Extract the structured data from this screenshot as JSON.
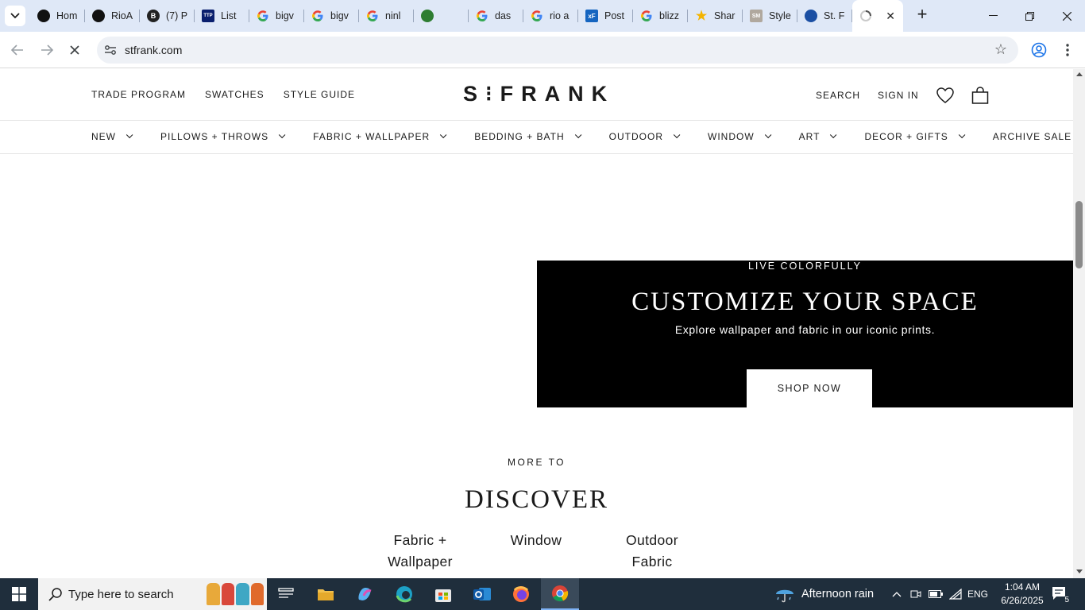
{
  "browser": {
    "tabs": [
      {
        "title": "Hom",
        "icon": "threads-icon",
        "color": "#111111"
      },
      {
        "title": "RioA",
        "icon": "threads-icon",
        "color": "#111111"
      },
      {
        "title": "(7) P",
        "icon": "b-icon",
        "color": "#222222"
      },
      {
        "title": "List",
        "icon": "ttp-icon",
        "color": "#0a1f6e"
      },
      {
        "title": "bigv",
        "icon": "google-icon",
        "color": "#4285f4"
      },
      {
        "title": "bigv",
        "icon": "google-icon",
        "color": "#4285f4"
      },
      {
        "title": "ninl",
        "icon": "google-icon",
        "color": "#4285f4"
      },
      {
        "title": "",
        "icon": "extension-icon",
        "color": "#2e7d32"
      },
      {
        "title": "das",
        "icon": "google-icon",
        "color": "#4285f4"
      },
      {
        "title": "rio a",
        "icon": "google-icon",
        "color": "#4285f4"
      },
      {
        "title": "Post",
        "icon": "xenforo-icon",
        "color": "#1565c0"
      },
      {
        "title": "blizz",
        "icon": "google-icon",
        "color": "#4285f4"
      },
      {
        "title": "Shar",
        "icon": "star-icon",
        "color": "#f4b400"
      },
      {
        "title": "Style",
        "icon": "sm-icon",
        "color": "#b0a89e"
      },
      {
        "title": "St. F",
        "icon": "stfrank-icon",
        "color": "#1b4fa3"
      },
      {
        "title": "",
        "icon": "loading-icon",
        "color": "#555555",
        "active": true
      }
    ],
    "url": "stfrank.com"
  },
  "site": {
    "utility_nav": [
      "TRADE PROGRAM",
      "SWATCHES",
      "STYLE GUIDE"
    ],
    "logo": "ST FRANK",
    "search_label": "SEARCH",
    "signin_label": "SIGN IN",
    "main_nav": [
      {
        "label": "NEW",
        "dropdown": true
      },
      {
        "label": "PILLOWS + THROWS",
        "dropdown": true
      },
      {
        "label": "FABRIC + WALLPAPER",
        "dropdown": true
      },
      {
        "label": "BEDDING + BATH",
        "dropdown": true
      },
      {
        "label": "OUTDOOR",
        "dropdown": true
      },
      {
        "label": "WINDOW",
        "dropdown": true
      },
      {
        "label": "ART",
        "dropdown": true
      },
      {
        "label": "DECOR + GIFTS",
        "dropdown": true
      },
      {
        "label": "ARCHIVE SALE",
        "dropdown": false
      }
    ],
    "banner": {
      "eyebrow": "LIVE COLORFULLY",
      "headline": "CUSTOMIZE YOUR SPACE",
      "subtext": "Explore wallpaper and fabric in our iconic prints.",
      "cta": "SHOP NOW"
    },
    "discover": {
      "eyebrow": "MORE TO",
      "title": "DISCOVER",
      "links": [
        {
          "line1": "Fabric +",
          "line2": "Wallpaper"
        },
        {
          "line1": "Window",
          "line2": ""
        },
        {
          "line1": "Outdoor",
          "line2": "Fabric"
        }
      ]
    }
  },
  "taskbar": {
    "search_placeholder": "Type here to search",
    "weather": "Afternoon rain",
    "language": "ENG",
    "time": "1:04 AM",
    "date": "6/26/2025",
    "notification_count": "5"
  }
}
